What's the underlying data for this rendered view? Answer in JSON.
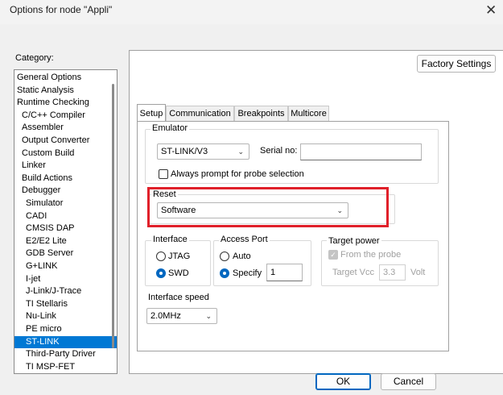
{
  "window": {
    "title": "Options for node \"Appli\""
  },
  "category": {
    "label": "Category:",
    "items": [
      {
        "label": "General Options",
        "indent": 0
      },
      {
        "label": "Static Analysis",
        "indent": 0
      },
      {
        "label": "Runtime Checking",
        "indent": 0
      },
      {
        "label": "C/C++ Compiler",
        "indent": 1
      },
      {
        "label": "Assembler",
        "indent": 1
      },
      {
        "label": "Output Converter",
        "indent": 1
      },
      {
        "label": "Custom Build",
        "indent": 1
      },
      {
        "label": "Linker",
        "indent": 1
      },
      {
        "label": "Build Actions",
        "indent": 1
      },
      {
        "label": "Debugger",
        "indent": 1
      },
      {
        "label": "Simulator",
        "indent": 2
      },
      {
        "label": "CADI",
        "indent": 2
      },
      {
        "label": "CMSIS DAP",
        "indent": 2
      },
      {
        "label": "E2/E2 Lite",
        "indent": 2
      },
      {
        "label": "GDB Server",
        "indent": 2
      },
      {
        "label": "G+LINK",
        "indent": 2
      },
      {
        "label": "I-jet",
        "indent": 2
      },
      {
        "label": "J-Link/J-Trace",
        "indent": 2
      },
      {
        "label": "TI Stellaris",
        "indent": 2
      },
      {
        "label": "Nu-Link",
        "indent": 2
      },
      {
        "label": "PE micro",
        "indent": 2
      },
      {
        "label": "ST-LINK",
        "indent": 2,
        "selected": true
      },
      {
        "label": "Third-Party Driver",
        "indent": 2
      },
      {
        "label": "TI MSP-FET",
        "indent": 2
      }
    ]
  },
  "buttons": {
    "factory": "Factory Settings",
    "ok": "OK",
    "cancel": "Cancel"
  },
  "tabs": [
    "Setup",
    "Communication",
    "Breakpoints",
    "Multicore"
  ],
  "emulator": {
    "label": "Emulator",
    "value": "ST-LINK/V3",
    "serial_label": "Serial no:",
    "serial_value": "",
    "always_prompt": "Always prompt for probe selection"
  },
  "reset": {
    "label": "Reset",
    "value": "Software"
  },
  "interface": {
    "label": "Interface",
    "jtag": "JTAG",
    "swd": "SWD",
    "selected": "SWD"
  },
  "access_port": {
    "label": "Access Port",
    "auto": "Auto",
    "specify": "Specify",
    "value": "1",
    "selected": "Specify"
  },
  "target_power": {
    "label": "Target power",
    "from_probe": "From the probe",
    "vcc_label": "Target Vcc",
    "vcc_value": "3.3",
    "unit": "Volt"
  },
  "speed": {
    "label": "Interface speed",
    "value": "2.0MHz"
  },
  "colors": {
    "selection": "#0078d4",
    "highlight": "#e0202a",
    "accent": "#0067c0"
  }
}
